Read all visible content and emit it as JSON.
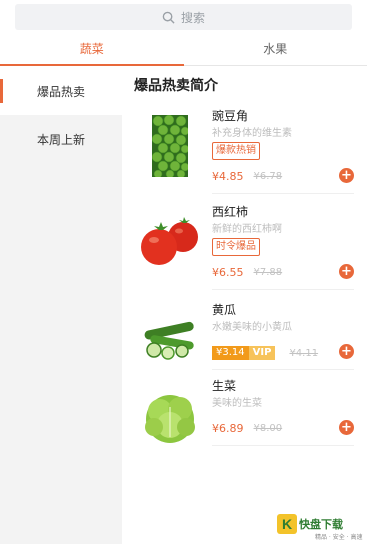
{
  "search": {
    "placeholder": "搜索"
  },
  "tabs": [
    {
      "label": "蔬菜",
      "active": true
    },
    {
      "label": "水果",
      "active": false
    }
  ],
  "sidebar": {
    "items": [
      {
        "label": "爆品热卖",
        "active": true
      },
      {
        "label": "本周上新",
        "active": false
      }
    ]
  },
  "section": {
    "title": "爆品热卖简介"
  },
  "products": [
    {
      "name": "豌豆角",
      "desc": "补充身体的维生素",
      "tag": "爆款热销",
      "price": "¥4.85",
      "old_price": "¥6.78",
      "image": "green-peas"
    },
    {
      "name": "西红柿",
      "desc": "新鲜的西红柿啊",
      "tag": "时令爆品",
      "price": "¥6.55",
      "old_price": "¥7.88",
      "image": "tomatoes"
    },
    {
      "name": "黄瓜",
      "desc": "水嫩美味的小黄瓜",
      "vip_price": "¥3.14",
      "vip_label": "VIP",
      "old_price": "¥4.11",
      "image": "cucumbers"
    },
    {
      "name": "生菜",
      "desc": "美味的生菜",
      "price": "¥6.89",
      "old_price": "¥8.00",
      "image": "lettuce"
    }
  ],
  "watermark": {
    "logo_text": "K",
    "brand": "快盘下载",
    "sub": "精品 · 安全 · 高速"
  },
  "colors": {
    "accent": "#e8683a",
    "vip": "#f29a1a",
    "sidebar_bg": "#f3f3f3"
  }
}
